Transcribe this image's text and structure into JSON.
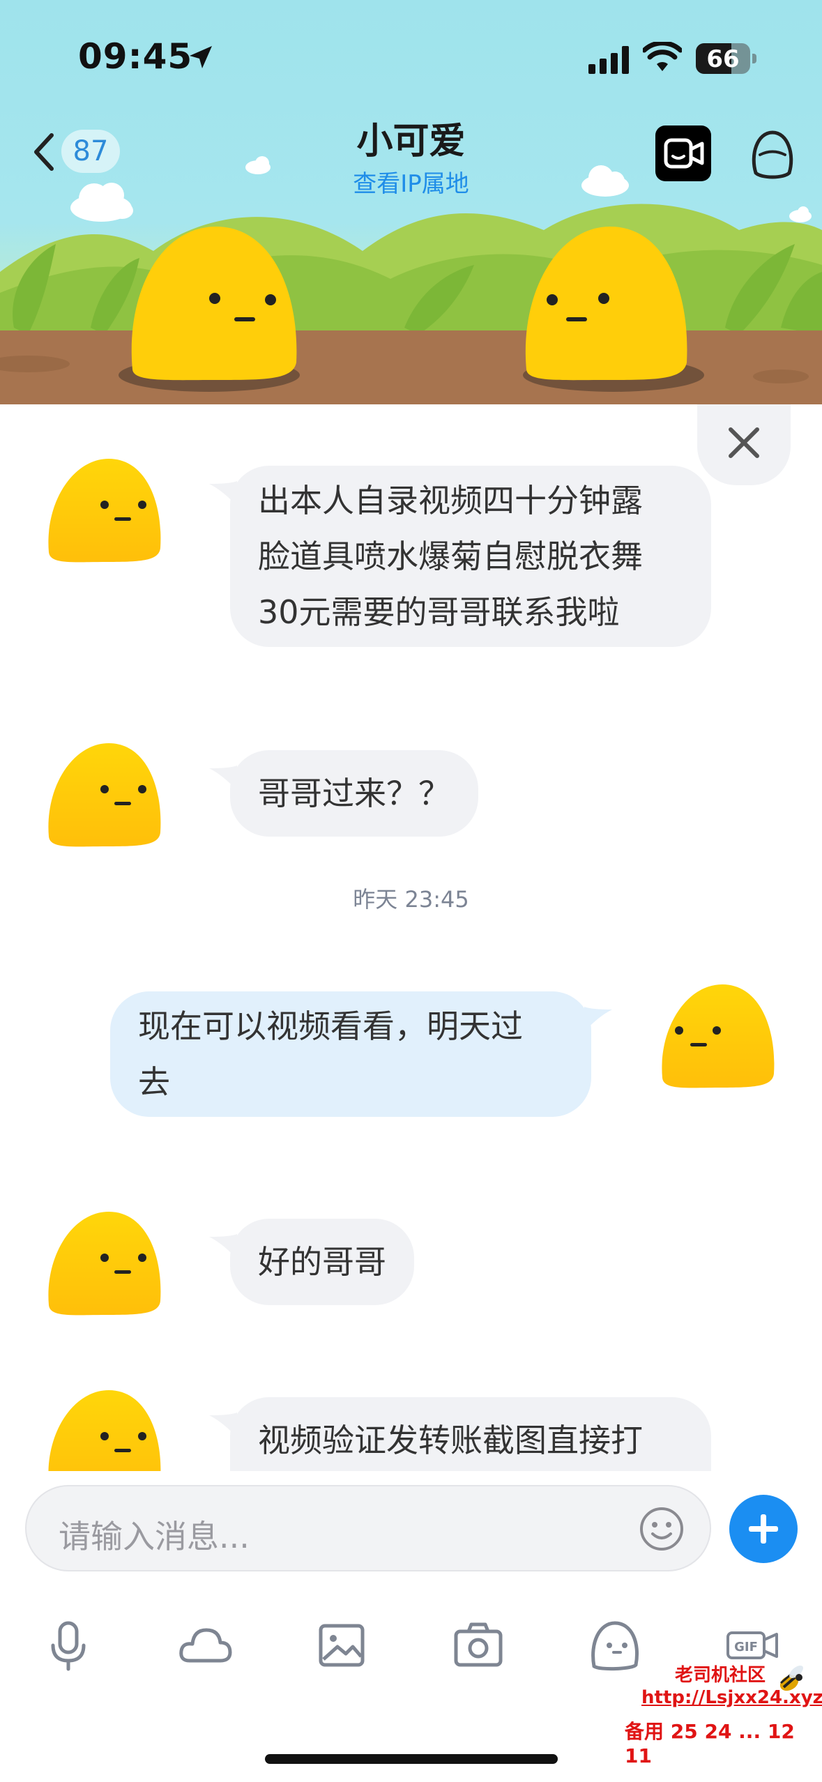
{
  "status_bar": {
    "time": "09:45",
    "battery": "66",
    "battery_level": 0.66
  },
  "header": {
    "back_count": "87",
    "title": "小可爱",
    "subtitle": "查看IP属地"
  },
  "messages": [
    {
      "side": "in",
      "text": "出本人自录视频四十分钟露\n脸道具喷水爆菊自慰脱衣舞\n30元需要的哥哥联系我啦"
    },
    {
      "side": "in",
      "text": "哥哥过来？？"
    },
    {
      "side": "out",
      "text": "现在可以视频看看，明天过\n去"
    },
    {
      "side": "in",
      "text": "好的哥哥"
    },
    {
      "side": "in",
      "text": "视频验证发转账截图直接打"
    }
  ],
  "timestamp": "昨天 23:45",
  "input": {
    "placeholder": "请输入消息..."
  },
  "toolbar": {
    "icons": [
      "mic-icon",
      "cloud-icon",
      "image-icon",
      "camera-icon",
      "face-icon",
      "gif-icon"
    ]
  },
  "watermark": {
    "line1": "老司机社区",
    "line2": "http://Lsjxx24.xyz",
    "line3": "备用 25 24 ... 12 11"
  },
  "colors": {
    "accent": "#1b8ef2",
    "incoming_bubble": "#f1f2f5",
    "outgoing_bubble": "#e1f0fc",
    "avatar_yellow": "#ffce0a"
  }
}
